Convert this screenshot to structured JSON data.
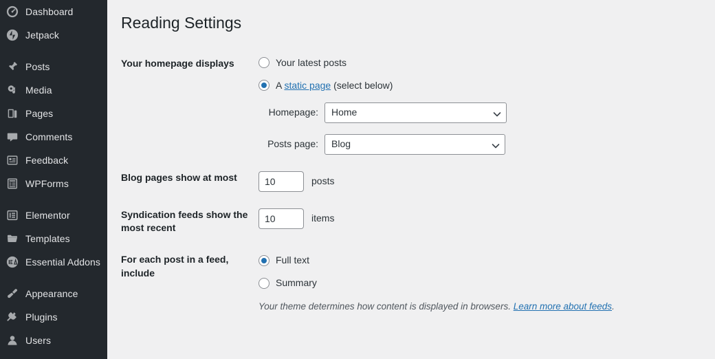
{
  "sidebar": {
    "items": [
      {
        "label": "Dashboard",
        "icon": "dashboard-icon",
        "gap_after": false
      },
      {
        "label": "Jetpack",
        "icon": "jetpack-icon",
        "gap_after": true
      },
      {
        "label": "Posts",
        "icon": "pin-icon",
        "gap_after": false
      },
      {
        "label": "Media",
        "icon": "media-icon",
        "gap_after": false
      },
      {
        "label": "Pages",
        "icon": "pages-icon",
        "gap_after": false
      },
      {
        "label": "Comments",
        "icon": "comments-icon",
        "gap_after": false
      },
      {
        "label": "Feedback",
        "icon": "feedback-icon",
        "gap_after": false
      },
      {
        "label": "WPForms",
        "icon": "wpforms-icon",
        "gap_after": true
      },
      {
        "label": "Elementor",
        "icon": "elementor-icon",
        "gap_after": false
      },
      {
        "label": "Templates",
        "icon": "folder-icon",
        "gap_after": false
      },
      {
        "label": "Essential Addons",
        "icon": "essential-addons-icon",
        "gap_after": true
      },
      {
        "label": "Appearance",
        "icon": "brush-icon",
        "gap_after": false
      },
      {
        "label": "Plugins",
        "icon": "plug-icon",
        "gap_after": false
      },
      {
        "label": "Users",
        "icon": "users-icon",
        "gap_after": false
      }
    ]
  },
  "page": {
    "title": "Reading Settings"
  },
  "homepage_section": {
    "label": "Your homepage displays",
    "options": [
      {
        "text": "Your latest posts",
        "checked": false
      },
      {
        "text_before": "A ",
        "link_text": "static page",
        "text_after": " (select below)",
        "checked": true
      }
    ],
    "selects": [
      {
        "caption": "Homepage:",
        "value": "Home"
      },
      {
        "caption": "Posts page:",
        "value": "Blog"
      }
    ]
  },
  "blog_pages": {
    "label": "Blog pages show at most",
    "value": "10",
    "unit": "posts"
  },
  "syndication": {
    "label": "Syndication feeds show the most recent",
    "value": "10",
    "unit": "items"
  },
  "feed_include": {
    "label": "For each post in a feed, include",
    "options": [
      {
        "text": "Full text",
        "checked": true
      },
      {
        "text": "Summary",
        "checked": false
      }
    ],
    "note_before": "Your theme determines how content is displayed in browsers. ",
    "note_link": "Learn more about feeds",
    "note_after": "."
  },
  "colors": {
    "sidebar_bg": "#23282d",
    "content_bg": "#f0f0f1",
    "accent": "#2271b1",
    "text": "#2c3338",
    "heading": "#1d2327",
    "border": "#8c8f94"
  }
}
